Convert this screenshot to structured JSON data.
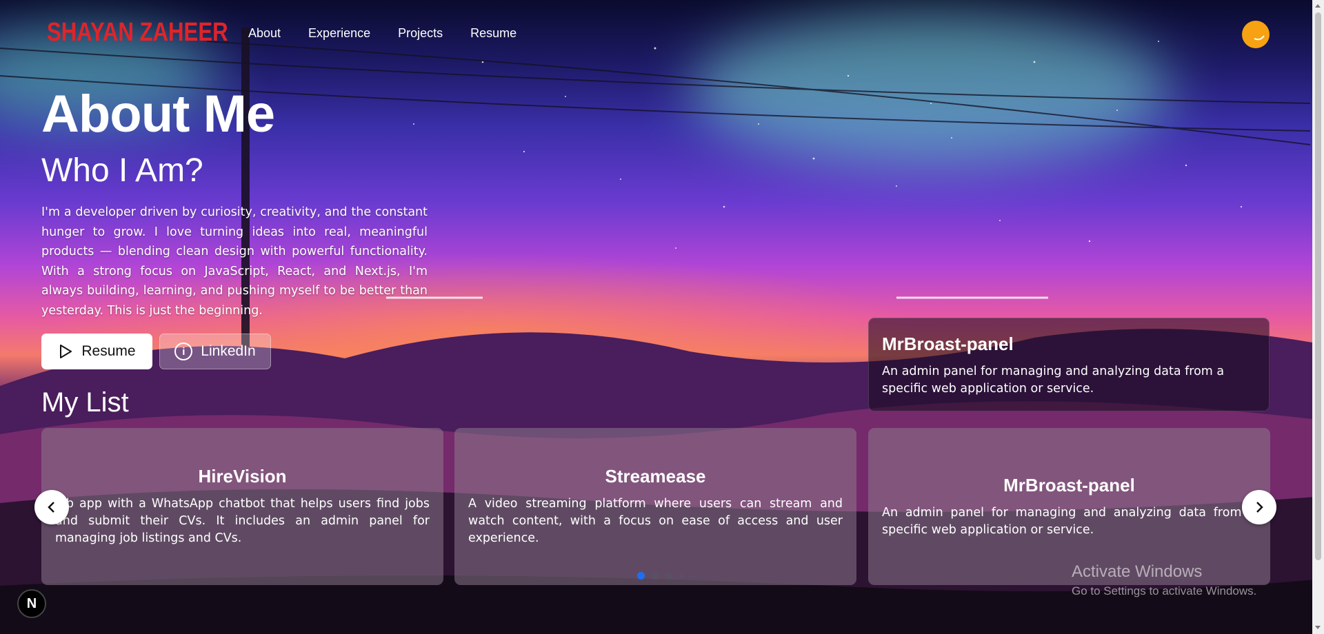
{
  "header": {
    "logo": "SHAYAN ZAHEER",
    "nav": [
      {
        "label": "About"
      },
      {
        "label": "Experience"
      },
      {
        "label": "Projects"
      },
      {
        "label": "Resume"
      }
    ],
    "avatar_color": "#f7a212"
  },
  "hero": {
    "title": "About Me",
    "subtitle": "Who I Am?",
    "bio": "I'm a developer driven by curiosity, creativity, and the constant hunger to grow. I love turning ideas into real, meaningful products — blending clean design with powerful functionality. With a strong focus on JavaScript, React, and Next.js, I'm always building, learning, and pushing myself to be better than yesterday. This is just the beginning.",
    "resume_button": "Resume",
    "linkedin_button": "LinkedIn"
  },
  "featured": {
    "title": "MrBroast-panel",
    "description": "An admin panel for managing and analyzing data from a specific web application or service."
  },
  "list": {
    "heading": "My List",
    "cards": [
      {
        "title": "HireVision",
        "description": "Job app with a WhatsApp chatbot that helps users find jobs and submit their CVs. It includes an admin panel for managing job listings and CVs."
      },
      {
        "title": "Streamease",
        "description": "A video streaming platform where users can stream and watch content, with a focus on ease of access and user experience."
      },
      {
        "title": "MrBroast-panel",
        "description": "An admin panel for managing and analyzing data from a specific web application or service."
      }
    ],
    "active_dot": 0,
    "dot_count": 5
  },
  "badge": "N",
  "watermark": {
    "line1": "Activate Windows",
    "line2": "Go to Settings to activate Windows."
  },
  "colors": {
    "logo": "#e0242a",
    "active_dot": "#1d6ff2"
  },
  "icons": [
    "play-icon",
    "info-icon",
    "chevron-left-icon",
    "chevron-right-icon"
  ]
}
